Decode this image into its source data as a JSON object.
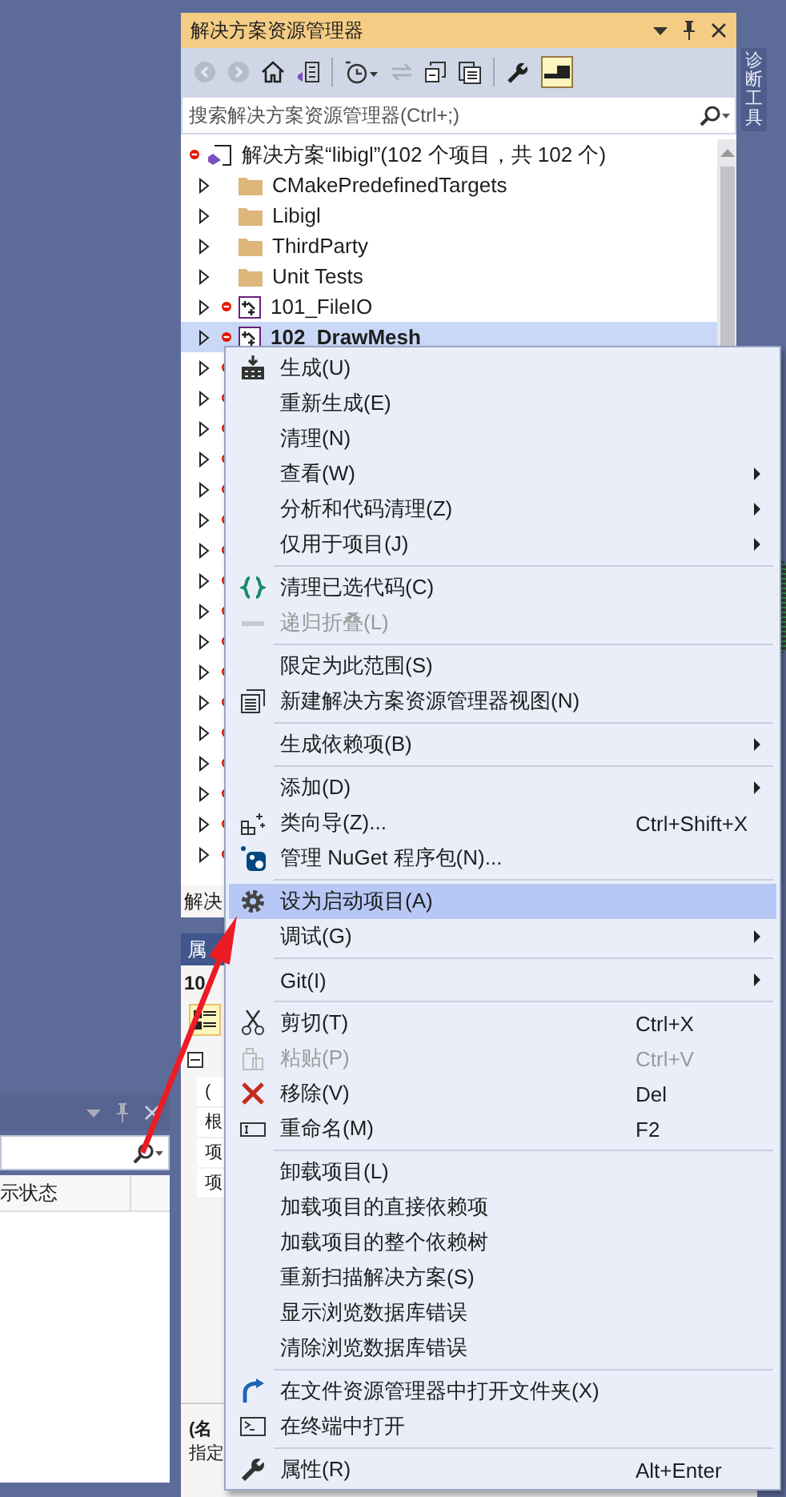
{
  "solution_explorer": {
    "title": "解决方案资源管理器",
    "search": {
      "placeholder": "搜索解决方案资源管理器(Ctrl+;)"
    },
    "tree": [
      {
        "kind": "solution",
        "label": "解决方案“libigl”(102 个项目，共 102 个)",
        "selected": false
      },
      {
        "kind": "folder",
        "label": "CMakePredefinedTargets",
        "expanded": false,
        "selected": false
      },
      {
        "kind": "folder",
        "label": "Libigl",
        "expanded": false,
        "selected": false
      },
      {
        "kind": "folder",
        "label": "ThirdParty",
        "expanded": false,
        "selected": false
      },
      {
        "kind": "folder",
        "label": "Unit Tests",
        "expanded": false,
        "selected": false
      },
      {
        "kind": "project",
        "label": "101_FileIO",
        "expanded": false,
        "selected": false
      },
      {
        "kind": "project",
        "label": "102_DrawMesh",
        "expanded": false,
        "selected": true
      },
      {
        "kind": "project",
        "expanded": false,
        "selected": false
      },
      {
        "kind": "project",
        "expanded": false,
        "selected": false
      },
      {
        "kind": "project",
        "expanded": false,
        "selected": false
      },
      {
        "kind": "project",
        "expanded": false,
        "selected": false
      },
      {
        "kind": "project",
        "expanded": false,
        "selected": false
      },
      {
        "kind": "project",
        "expanded": false,
        "selected": false
      },
      {
        "kind": "project",
        "expanded": false,
        "selected": false
      },
      {
        "kind": "project",
        "expanded": false,
        "selected": false
      },
      {
        "kind": "project",
        "expanded": false,
        "selected": false
      },
      {
        "kind": "project",
        "expanded": false,
        "selected": false
      },
      {
        "kind": "project",
        "expanded": false,
        "selected": false
      },
      {
        "kind": "project",
        "expanded": false,
        "selected": false
      },
      {
        "kind": "project",
        "expanded": false,
        "selected": false
      },
      {
        "kind": "project",
        "expanded": false,
        "selected": false
      },
      {
        "kind": "project",
        "expanded": false,
        "selected": false
      },
      {
        "kind": "project",
        "expanded": false,
        "selected": false
      },
      {
        "kind": "project",
        "expanded": false,
        "selected": false
      }
    ],
    "footer_tab": "解决"
  },
  "side_tab": "诊断工具",
  "properties": {
    "title": "属",
    "object": "10",
    "rows": [
      "(",
      "根",
      "项",
      "项"
    ],
    "description_title": "(名",
    "description": "指定"
  },
  "output_panel": {
    "column": "示状态"
  },
  "context_menu": [
    {
      "kind": "item",
      "label": "生成(U)",
      "has_submenu": false,
      "disabled": false,
      "selected": false
    },
    {
      "kind": "item",
      "label": "重新生成(E)",
      "has_submenu": false,
      "disabled": false,
      "selected": false
    },
    {
      "kind": "item",
      "label": "清理(N)",
      "has_submenu": false,
      "disabled": false,
      "selected": false
    },
    {
      "kind": "item",
      "label": "查看(W)",
      "has_submenu": true,
      "disabled": false,
      "selected": false
    },
    {
      "kind": "item",
      "label": "分析和代码清理(Z)",
      "has_submenu": true,
      "disabled": false,
      "selected": false
    },
    {
      "kind": "item",
      "label": "仅用于项目(J)",
      "has_submenu": true,
      "disabled": false,
      "selected": false
    },
    {
      "kind": "separator"
    },
    {
      "kind": "item",
      "label": "清理已选代码(C)",
      "has_submenu": false,
      "disabled": false,
      "selected": false
    },
    {
      "kind": "item",
      "label": "递归折叠(L)",
      "has_submenu": false,
      "disabled": true,
      "selected": false
    },
    {
      "kind": "separator"
    },
    {
      "kind": "item",
      "label": "限定为此范围(S)",
      "has_submenu": false,
      "disabled": false,
      "selected": false
    },
    {
      "kind": "item",
      "label": "新建解决方案资源管理器视图(N)",
      "has_submenu": false,
      "disabled": false,
      "selected": false
    },
    {
      "kind": "separator"
    },
    {
      "kind": "item",
      "label": "生成依赖项(B)",
      "has_submenu": true,
      "disabled": false,
      "selected": false
    },
    {
      "kind": "separator"
    },
    {
      "kind": "item",
      "label": "添加(D)",
      "has_submenu": true,
      "disabled": false,
      "selected": false
    },
    {
      "kind": "item",
      "label": "类向导(Z)...",
      "shortcut": "Ctrl+Shift+X",
      "has_submenu": false,
      "disabled": false,
      "selected": false
    },
    {
      "kind": "item",
      "label": "管理 NuGet 程序包(N)...",
      "has_submenu": false,
      "disabled": false,
      "selected": false
    },
    {
      "kind": "separator"
    },
    {
      "kind": "item",
      "label": "设为启动项目(A)",
      "has_submenu": false,
      "disabled": false,
      "selected": true
    },
    {
      "kind": "item",
      "label": "调试(G)",
      "has_submenu": true,
      "disabled": false,
      "selected": false
    },
    {
      "kind": "separator"
    },
    {
      "kind": "item",
      "label": "Git(I)",
      "has_submenu": true,
      "disabled": false,
      "selected": false
    },
    {
      "kind": "separator"
    },
    {
      "kind": "item",
      "label": "剪切(T)",
      "shortcut": "Ctrl+X",
      "has_submenu": false,
      "disabled": false,
      "selected": false
    },
    {
      "kind": "item",
      "label": "粘贴(P)",
      "shortcut": "Ctrl+V",
      "has_submenu": false,
      "disabled": true,
      "selected": false
    },
    {
      "kind": "item",
      "label": "移除(V)",
      "shortcut": "Del",
      "has_submenu": false,
      "disabled": false,
      "selected": false
    },
    {
      "kind": "item",
      "label": "重命名(M)",
      "shortcut": "F2",
      "has_submenu": false,
      "disabled": false,
      "selected": false
    },
    {
      "kind": "separator"
    },
    {
      "kind": "item",
      "label": "卸载项目(L)",
      "has_submenu": false,
      "disabled": false,
      "selected": false
    },
    {
      "kind": "item",
      "label": "加载项目的直接依赖项",
      "has_submenu": false,
      "disabled": false,
      "selected": false
    },
    {
      "kind": "item",
      "label": "加载项目的整个依赖树",
      "has_submenu": false,
      "disabled": false,
      "selected": false
    },
    {
      "kind": "item",
      "label": "重新扫描解决方案(S)",
      "has_submenu": false,
      "disabled": false,
      "selected": false
    },
    {
      "kind": "item",
      "label": "显示浏览数据库错误",
      "has_submenu": false,
      "disabled": false,
      "selected": false
    },
    {
      "kind": "item",
      "label": "清除浏览数据库错误",
      "has_submenu": false,
      "disabled": false,
      "selected": false
    },
    {
      "kind": "separator"
    },
    {
      "kind": "item",
      "label": "在文件资源管理器中打开文件夹(X)",
      "has_submenu": false,
      "disabled": false,
      "selected": false
    },
    {
      "kind": "item",
      "label": "在终端中打开",
      "has_submenu": false,
      "disabled": false,
      "selected": false
    },
    {
      "kind": "separator"
    },
    {
      "kind": "item",
      "label": "属性(R)",
      "shortcut": "Alt+Enter",
      "has_submenu": false,
      "disabled": false,
      "selected": false
    }
  ]
}
